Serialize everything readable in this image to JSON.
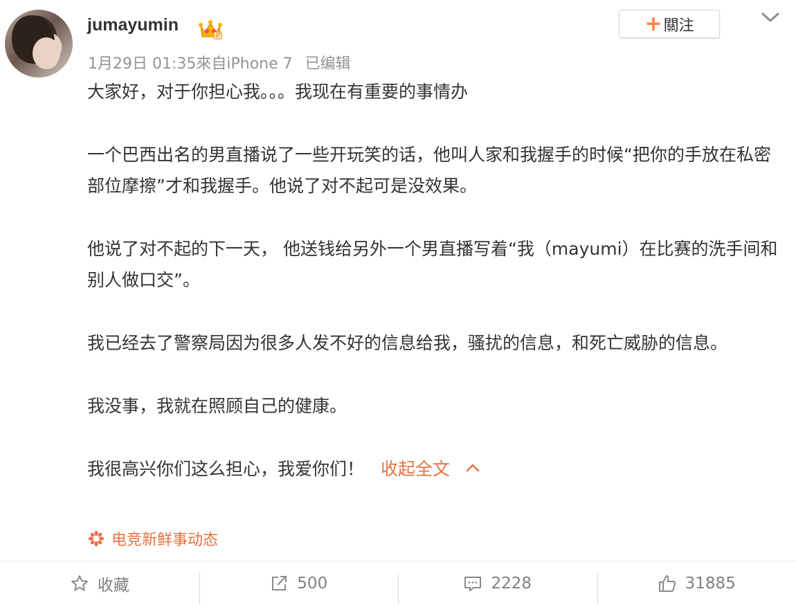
{
  "post": {
    "username": "jumayumin",
    "timestamp": "1月29日 01:35來自iPhone 7",
    "edited_label": "已编辑",
    "follow_label": "關注",
    "paragraphs": [
      "大家好，对于你担心我。。。我现在有重要的事情办",
      "一个巴西出名的男直播说了一些开玩笑的话，他叫人家和我握手的时候“把你的手放在私密部位摩擦”才和我握手。他说了对不起可是没效果。",
      "他说了对不起的下一天， 他送钱给另外一个男直播写着“我（mayumi）在比赛的洗手间和别人做口交”。",
      "我已经去了警察局因为很多人发不好的信息给我，骚扰的信息，和死亡威胁的信息。",
      "我没事，我就在照顾自己的健康。",
      "我很高兴你们这么担心，我爱你们！"
    ],
    "collapse_label": "收起全文",
    "topic_label": "电竞新鲜事动态"
  },
  "actions": {
    "favorite_label": "收藏",
    "repost_count": "500",
    "comment_count": "2228",
    "like_count": "31885"
  },
  "colors": {
    "accent": "#e8713f",
    "text": "#333333",
    "meta": "#939393"
  },
  "icons": [
    "vip-crown-icon",
    "chevron-down-icon",
    "chevron-up-icon",
    "topic-flower-icon",
    "star-icon",
    "share-icon",
    "comment-icon",
    "thumbs-up-icon"
  ]
}
